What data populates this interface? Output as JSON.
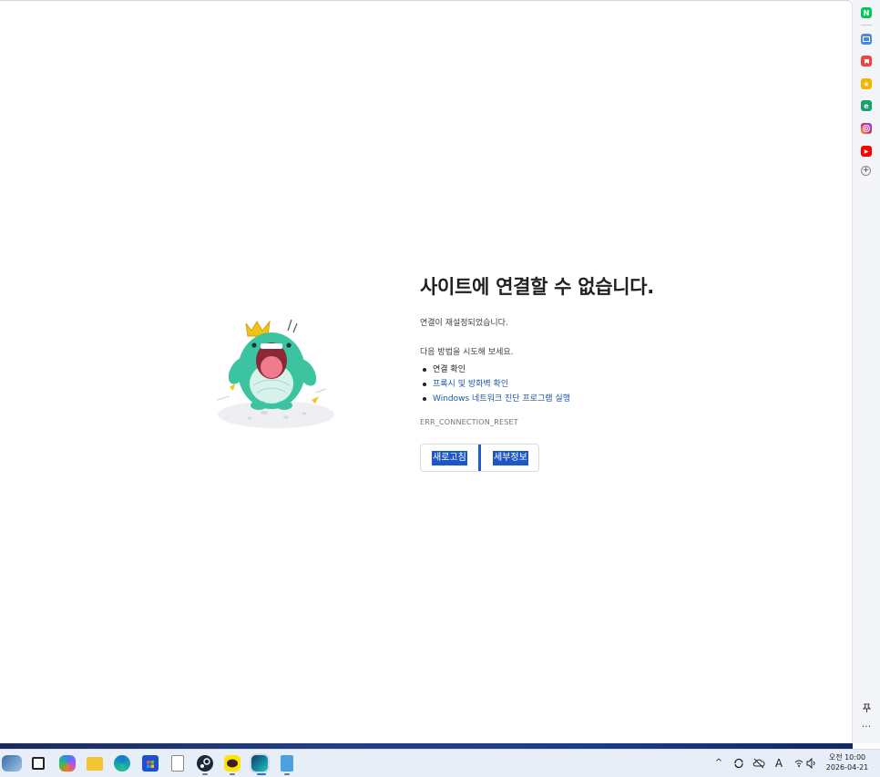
{
  "error": {
    "title": "사이트에 연결할 수 없습니다.",
    "subtitle": "연결이 재설정되었습니다.",
    "try_heading": "다음 방법을 시도해 보세요.",
    "suggestions": [
      "연결 확인",
      "프록시 및 방화벽 확인",
      "Windows 네트워크 진단 프로그램 실행"
    ],
    "error_code": "ERR_CONNECTION_RESET",
    "reload_label": "새로고침",
    "details_label": "세부정보"
  },
  "sidebar": {
    "apps": [
      {
        "icon": "naver-icon",
        "letter": "N",
        "color": "#03c75a"
      },
      {
        "icon": "mail-icon",
        "letter": "",
        "color": "#4a86e8"
      },
      {
        "icon": "bookmark-icon",
        "letter": "",
        "color": "#ef4444"
      },
      {
        "icon": "star-icon",
        "letter": "★",
        "color": "#f5b400"
      },
      {
        "icon": "edge-icon",
        "letter": "e",
        "color": "#18a36b"
      },
      {
        "icon": "instagram-icon",
        "letter": "",
        "color": "#d62976"
      },
      {
        "icon": "youtube-icon",
        "letter": "▶",
        "color": "#ff0000"
      }
    ],
    "add_glyph": "+",
    "pin_glyph": "📌",
    "more_glyph": "···"
  },
  "taskbar": {
    "apps": [
      "copilot-icon",
      "file-explorer-icon",
      "edge-icon",
      "store-icon",
      "notepad-icon",
      "steam-icon",
      "kakaotalk-icon",
      "whale-icon",
      "notes-icon"
    ],
    "tray": {
      "chevron": "^",
      "ime": "A"
    },
    "clock": {
      "time": "오전 10:00",
      "date": "2026-04-21"
    }
  },
  "colors": {
    "accent": "#1d56c5",
    "link": "#1a56a8"
  }
}
